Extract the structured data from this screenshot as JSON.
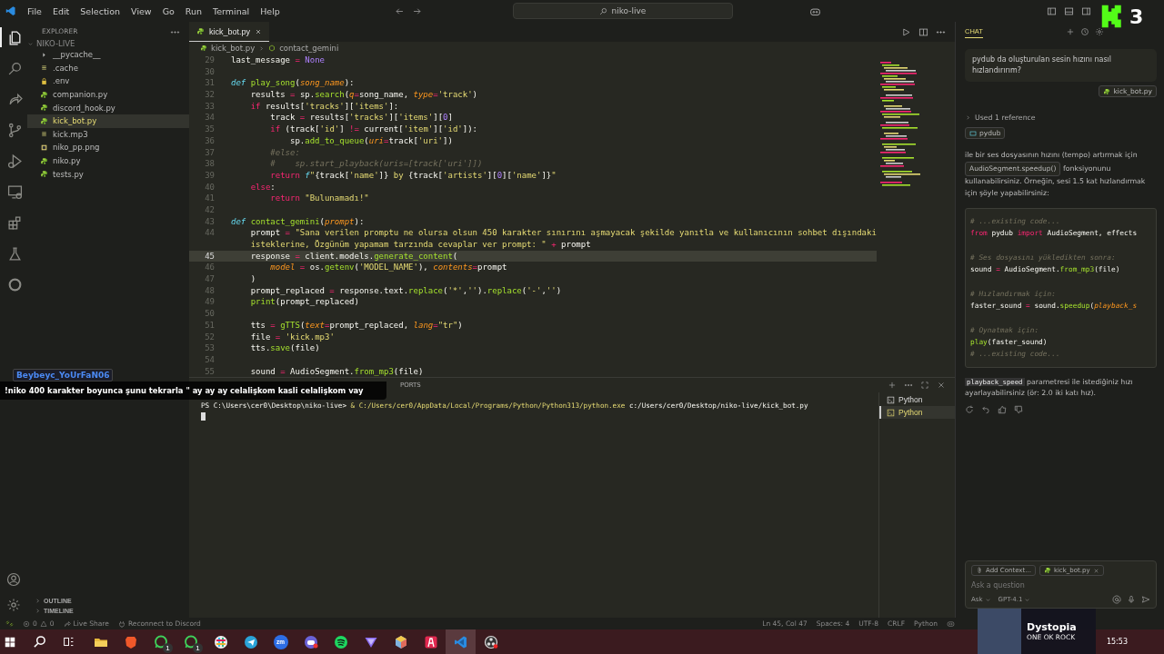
{
  "title_bar": {
    "menu": [
      "File",
      "Edit",
      "Selection",
      "View",
      "Go",
      "Run",
      "Terminal",
      "Help"
    ],
    "search": "niko-live"
  },
  "activity_bar": [
    {
      "kind": "files",
      "selected": true
    },
    {
      "kind": "search",
      "selected": false
    },
    {
      "kind": "share",
      "selected": false
    },
    {
      "kind": "branch",
      "selected": false
    },
    {
      "kind": "debug",
      "selected": false
    },
    {
      "kind": "monitor",
      "selected": false
    },
    {
      "kind": "extensions",
      "selected": false
    },
    {
      "kind": "flask",
      "selected": false
    },
    {
      "kind": "ring",
      "selected": false
    }
  ],
  "activity_bottom": [
    {
      "kind": "account"
    },
    {
      "kind": "settings"
    }
  ],
  "explorer": {
    "title": "EXPLORER",
    "folder": "NIKO-LIVE",
    "files": [
      {
        "name": "__pycache__",
        "kind": "folder",
        "selected": false
      },
      {
        "name": ".cache",
        "kind": "file",
        "selected": false
      },
      {
        "name": ".env",
        "kind": "lock",
        "selected": false
      },
      {
        "name": "companion.py",
        "kind": "python",
        "selected": false
      },
      {
        "name": "discord_hook.py",
        "kind": "python",
        "selected": false
      },
      {
        "name": "kick_bot.py",
        "kind": "python",
        "selected": true
      },
      {
        "name": "kick.mp3",
        "kind": "file",
        "selected": false
      },
      {
        "name": "niko_pp.png",
        "kind": "image",
        "selected": false
      },
      {
        "name": "niko.py",
        "kind": "python",
        "selected": false
      },
      {
        "name": "tests.py",
        "kind": "python",
        "selected": false
      }
    ],
    "sections": [
      "OUTLINE",
      "TIMELINE"
    ]
  },
  "editor": {
    "tab": "kick_bot.py",
    "breadcrumb": [
      "kick_bot.py",
      "contact_gemini"
    ],
    "lines": [
      {
        "number": "29",
        "kind": "code",
        "current": false,
        "tokens": [
          {
            "text": "last_message",
            "kind": "plain"
          },
          {
            "text": " = ",
            "kind": "op"
          },
          {
            "text": "None",
            "kind": "const"
          }
        ]
      },
      {
        "number": "30",
        "kind": "blank",
        "current": false
      },
      {
        "number": "31",
        "kind": "code",
        "current": false,
        "tokens": [
          {
            "text": "def ",
            "kind": "kw"
          },
          {
            "text": "play_song",
            "kind": "fn"
          },
          {
            "text": "(",
            "kind": "plain"
          },
          {
            "text": "song_name",
            "kind": "param"
          },
          {
            "text": "):",
            "kind": "plain"
          }
        ]
      },
      {
        "number": "32",
        "kind": "code",
        "current": false,
        "tokens": [
          {
            "text": "    results",
            "kind": "plain"
          },
          {
            "text": " = ",
            "kind": "op"
          },
          {
            "text": "sp.",
            "kind": "plain"
          },
          {
            "text": "search",
            "kind": "fn"
          },
          {
            "text": "(",
            "kind": "plain"
          },
          {
            "text": "q",
            "kind": "param"
          },
          {
            "text": "=",
            "kind": "op"
          },
          {
            "text": "song_name, ",
            "kind": "plain"
          },
          {
            "text": "type",
            "kind": "param"
          },
          {
            "text": "=",
            "kind": "op"
          },
          {
            "text": "'track'",
            "kind": "str"
          },
          {
            "text": ")",
            "kind": "plain"
          }
        ]
      },
      {
        "number": "33",
        "kind": "code",
        "current": false,
        "tokens": [
          {
            "text": "    if",
            "kind": "ctrl"
          },
          {
            "text": " results[",
            "kind": "plain"
          },
          {
            "text": "'tracks'",
            "kind": "str"
          },
          {
            "text": "][",
            "kind": "plain"
          },
          {
            "text": "'items'",
            "kind": "str"
          },
          {
            "text": "]:",
            "kind": "plain"
          }
        ]
      },
      {
        "number": "34",
        "kind": "code",
        "current": false,
        "tokens": [
          {
            "text": "        track",
            "kind": "plain"
          },
          {
            "text": " = ",
            "kind": "op"
          },
          {
            "text": "results[",
            "kind": "plain"
          },
          {
            "text": "'tracks'",
            "kind": "str"
          },
          {
            "text": "][",
            "kind": "plain"
          },
          {
            "text": "'items'",
            "kind": "str"
          },
          {
            "text": "][",
            "kind": "plain"
          },
          {
            "text": "0",
            "kind": "num"
          },
          {
            "text": "]",
            "kind": "plain"
          }
        ]
      },
      {
        "number": "35",
        "kind": "code",
        "current": false,
        "tokens": [
          {
            "text": "        if",
            "kind": "ctrl"
          },
          {
            "text": " (track[",
            "kind": "plain"
          },
          {
            "text": "'id'",
            "kind": "str"
          },
          {
            "text": "] ",
            "kind": "plain"
          },
          {
            "text": "!=",
            "kind": "op"
          },
          {
            "text": " current[",
            "kind": "plain"
          },
          {
            "text": "'item'",
            "kind": "str"
          },
          {
            "text": "][",
            "kind": "plain"
          },
          {
            "text": "'id'",
            "kind": "str"
          },
          {
            "text": "]):",
            "kind": "plain"
          }
        ]
      },
      {
        "number": "36",
        "kind": "code",
        "current": false,
        "tokens": [
          {
            "text": "            sp.",
            "kind": "plain"
          },
          {
            "text": "add_to_queue",
            "kind": "fn"
          },
          {
            "text": "(",
            "kind": "plain"
          },
          {
            "text": "uri",
            "kind": "param"
          },
          {
            "text": "=",
            "kind": "op"
          },
          {
            "text": "track[",
            "kind": "plain"
          },
          {
            "text": "'uri'",
            "kind": "str"
          },
          {
            "text": "])",
            "kind": "plain"
          }
        ]
      },
      {
        "number": "37",
        "kind": "code",
        "current": false,
        "tokens": [
          {
            "text": "        #else:",
            "kind": "comment"
          }
        ]
      },
      {
        "number": "38",
        "kind": "code",
        "current": false,
        "tokens": [
          {
            "text": "        #    sp.start_playback(uris=[track['uri']])",
            "kind": "comment"
          }
        ]
      },
      {
        "number": "39",
        "kind": "code",
        "current": false,
        "tokens": [
          {
            "text": "        return ",
            "kind": "ctrl"
          },
          {
            "text": "f",
            "kind": "kw"
          },
          {
            "text": "\"",
            "kind": "str"
          },
          {
            "text": "{track[",
            "kind": "plain"
          },
          {
            "text": "'name'",
            "kind": "str"
          },
          {
            "text": "]}",
            "kind": "plain"
          },
          {
            "text": " by ",
            "kind": "str"
          },
          {
            "text": "{track[",
            "kind": "plain"
          },
          {
            "text": "'artists'",
            "kind": "str"
          },
          {
            "text": "][",
            "kind": "plain"
          },
          {
            "text": "0",
            "kind": "num"
          },
          {
            "text": "][",
            "kind": "plain"
          },
          {
            "text": "'name'",
            "kind": "str"
          },
          {
            "text": "]}",
            "kind": "plain"
          },
          {
            "text": "\"",
            "kind": "str"
          }
        ]
      },
      {
        "number": "40",
        "kind": "code",
        "current": false,
        "tokens": [
          {
            "text": "    else",
            "kind": "ctrl"
          },
          {
            "text": ":",
            "kind": "plain"
          }
        ]
      },
      {
        "number": "41",
        "kind": "code",
        "current": false,
        "tokens": [
          {
            "text": "        return ",
            "kind": "ctrl"
          },
          {
            "text": "\"Bulunamadı!\"",
            "kind": "str"
          }
        ]
      },
      {
        "number": "42",
        "kind": "blank",
        "current": false
      },
      {
        "number": "43",
        "kind": "code",
        "current": false,
        "tokens": [
          {
            "text": "def ",
            "kind": "kw"
          },
          {
            "text": "contact_gemini",
            "kind": "fn"
          },
          {
            "text": "(",
            "kind": "plain"
          },
          {
            "text": "prompt",
            "kind": "param"
          },
          {
            "text": "):",
            "kind": "plain"
          }
        ]
      },
      {
        "number": "44",
        "kind": "code",
        "current": false,
        "tokens": [
          {
            "text": "    prompt",
            "kind": "plain"
          },
          {
            "text": " = ",
            "kind": "op"
          },
          {
            "text": "\"Sana verilen promptu ne olursa olsun 450 karakter sınırını aşmayacak şekilde yanıtla ve kullanıcının sohbet dışındaki",
            "kind": "str"
          }
        ]
      },
      {
        "kind": "wrap",
        "current": false,
        "tokens": [
          {
            "text": "    isteklerine, Özgünüm yapamam tarzında cevaplar ver prompt: \"",
            "kind": "str"
          },
          {
            "text": " + ",
            "kind": "op"
          },
          {
            "text": "prompt",
            "kind": "plain"
          }
        ]
      },
      {
        "number": "45",
        "kind": "code",
        "current": true,
        "tokens": [
          {
            "text": "    response",
            "kind": "plain"
          },
          {
            "text": " = ",
            "kind": "op"
          },
          {
            "text": "client.models.",
            "kind": "plain"
          },
          {
            "text": "generate_content",
            "kind": "fn"
          },
          {
            "text": "(",
            "kind": "plain"
          }
        ]
      },
      {
        "number": "46",
        "kind": "code",
        "current": false,
        "tokens": [
          {
            "text": "        model",
            "kind": "param"
          },
          {
            "text": " = ",
            "kind": "op"
          },
          {
            "text": "os.",
            "kind": "plain"
          },
          {
            "text": "getenv",
            "kind": "fn"
          },
          {
            "text": "(",
            "kind": "plain"
          },
          {
            "text": "'MODEL_NAME'",
            "kind": "str"
          },
          {
            "text": "), ",
            "kind": "plain"
          },
          {
            "text": "contents",
            "kind": "param"
          },
          {
            "text": "=",
            "kind": "op"
          },
          {
            "text": "prompt",
            "kind": "plain"
          }
        ]
      },
      {
        "number": "47",
        "kind": "code",
        "current": false,
        "tokens": [
          {
            "text": "    )",
            "kind": "plain"
          }
        ]
      },
      {
        "number": "48",
        "kind": "code",
        "current": false,
        "tokens": [
          {
            "text": "    prompt_replaced",
            "kind": "plain"
          },
          {
            "text": " = ",
            "kind": "op"
          },
          {
            "text": "response.text.",
            "kind": "plain"
          },
          {
            "text": "replace",
            "kind": "fn"
          },
          {
            "text": "(",
            "kind": "plain"
          },
          {
            "text": "'*'",
            "kind": "str"
          },
          {
            "text": ",",
            "kind": "plain"
          },
          {
            "text": "''",
            "kind": "str"
          },
          {
            "text": ").",
            "kind": "plain"
          },
          {
            "text": "replace",
            "kind": "fn"
          },
          {
            "text": "(",
            "kind": "plain"
          },
          {
            "text": "'-'",
            "kind": "str"
          },
          {
            "text": ",",
            "kind": "plain"
          },
          {
            "text": "''",
            "kind": "str"
          },
          {
            "text": ")",
            "kind": "plain"
          }
        ]
      },
      {
        "number": "49",
        "kind": "code",
        "current": false,
        "tokens": [
          {
            "text": "    print",
            "kind": "fn"
          },
          {
            "text": "(prompt_replaced)",
            "kind": "plain"
          }
        ]
      },
      {
        "number": "50",
        "kind": "blank",
        "current": false
      },
      {
        "number": "51",
        "kind": "code",
        "current": false,
        "tokens": [
          {
            "text": "    tts",
            "kind": "plain"
          },
          {
            "text": " = ",
            "kind": "op"
          },
          {
            "text": "gTTS",
            "kind": "fn"
          },
          {
            "text": "(",
            "kind": "plain"
          },
          {
            "text": "text",
            "kind": "param"
          },
          {
            "text": "=",
            "kind": "op"
          },
          {
            "text": "prompt_replaced, ",
            "kind": "plain"
          },
          {
            "text": "lang",
            "kind": "param"
          },
          {
            "text": "=",
            "kind": "op"
          },
          {
            "text": "\"tr\"",
            "kind": "str"
          },
          {
            "text": ")",
            "kind": "plain"
          }
        ]
      },
      {
        "number": "52",
        "kind": "code",
        "current": false,
        "tokens": [
          {
            "text": "    file",
            "kind": "plain"
          },
          {
            "text": " = ",
            "kind": "op"
          },
          {
            "text": "'kick.mp3'",
            "kind": "str"
          }
        ]
      },
      {
        "number": "53",
        "kind": "code",
        "current": false,
        "tokens": [
          {
            "text": "    tts.",
            "kind": "plain"
          },
          {
            "text": "save",
            "kind": "fn"
          },
          {
            "text": "(file)",
            "kind": "plain"
          }
        ]
      },
      {
        "number": "54",
        "kind": "blank",
        "current": false
      },
      {
        "number": "55",
        "kind": "code",
        "current": false,
        "tokens": [
          {
            "text": "    sound",
            "kind": "plain"
          },
          {
            "text": " = ",
            "kind": "op"
          },
          {
            "text": "AudioSegment.",
            "kind": "plain"
          },
          {
            "text": "from_mp3",
            "kind": "fn"
          },
          {
            "text": "(file)",
            "kind": "plain"
          }
        ]
      }
    ]
  },
  "panel": {
    "tabs": [
      "PORTS"
    ],
    "terminal_lines": [
      [
        {
          "text": "PS C:\\Users\\cer0\\Desktop\\niko-live> ",
          "kind": "plain"
        },
        {
          "text": "& C:/Users/cer0/AppData/Local/Programs/Python/Python313/python.exe",
          "kind": "str"
        },
        {
          "text": " c:/Users/cer0/Desktop/niko-live/kick_bot.py",
          "kind": "plain"
        }
      ]
    ],
    "terminals": [
      {
        "label": "Python",
        "selected": false
      },
      {
        "label": "Python",
        "selected": true
      }
    ]
  },
  "chat": {
    "title": "CHAT",
    "question": "pydub da oluşturulan sesin hızını nasıl hızlandırırım?",
    "attachment": "kick_bot.py",
    "references": "Used 1 reference",
    "reference_chip": "pydub",
    "answer": {
      "before": "ile bir ses dosyasının hızını (tempo) artırmak için",
      "symbol": "AudioSegment.speedup()",
      "after": "fonksiyonunu kullanabilirsiniz. Örneğin, sesi 1.5 kat hızlandırmak için şöyle yapabilirsiniz:"
    },
    "code": [
      {
        "kind": "code",
        "tokens": [
          {
            "text": "# ...existing code...",
            "kind": "comment"
          }
        ]
      },
      {
        "kind": "code",
        "tokens": [
          {
            "text": "from",
            "kind": "ctrl"
          },
          {
            "text": " pydub ",
            "kind": "plain"
          },
          {
            "text": "import",
            "kind": "ctrl"
          },
          {
            "text": " AudioSegment, effects",
            "kind": "plain"
          }
        ]
      },
      {
        "kind": "blank"
      },
      {
        "kind": "code",
        "tokens": [
          {
            "text": "# Ses dosyasını yükledikten sonra:",
            "kind": "comment"
          }
        ]
      },
      {
        "kind": "code",
        "tokens": [
          {
            "text": "sound",
            "kind": "plain"
          },
          {
            "text": " = ",
            "kind": "op"
          },
          {
            "text": "AudioSegment.",
            "kind": "plain"
          },
          {
            "text": "from_mp3",
            "kind": "fn"
          },
          {
            "text": "(file)",
            "kind": "plain"
          }
        ]
      },
      {
        "kind": "blank"
      },
      {
        "kind": "code",
        "tokens": [
          {
            "text": "# Hızlandırmak için:",
            "kind": "comment"
          }
        ]
      },
      {
        "kind": "code",
        "tokens": [
          {
            "text": "faster_sound",
            "kind": "plain"
          },
          {
            "text": " = ",
            "kind": "op"
          },
          {
            "text": "sound.",
            "kind": "plain"
          },
          {
            "text": "speedup",
            "kind": "fn"
          },
          {
            "text": "(",
            "kind": "plain"
          },
          {
            "text": "playback_s",
            "kind": "param"
          }
        ]
      },
      {
        "kind": "blank"
      },
      {
        "kind": "code",
        "tokens": [
          {
            "text": "# Oynatmak için:",
            "kind": "comment"
          }
        ]
      },
      {
        "kind": "code",
        "tokens": [
          {
            "text": "play",
            "kind": "fn"
          },
          {
            "text": "(faster_sound)",
            "kind": "plain"
          }
        ]
      },
      {
        "kind": "code",
        "tokens": [
          {
            "text": "# ...existing code...",
            "kind": "comment"
          }
        ]
      }
    ],
    "note_code": "playback_speed",
    "note": "parametresi ile istediğiniz hızı ayarlayabilirsiniz (ör: 2.0 iki katı hız).",
    "input": {
      "context_button": "Add Context...",
      "file_chip": "kick_bot.py",
      "placeholder": "Ask a question",
      "mode": "Ask",
      "model": "GPT-4.1"
    }
  },
  "status_bar": {
    "errors": "0",
    "warnings": "0",
    "left": [
      "Live Share",
      "Reconnect to Discord"
    ],
    "right": [
      "Ln 45, Col 47",
      "Spaces: 4",
      "UTF-8",
      "CRLF",
      "Python"
    ]
  },
  "taskbar": {
    "apps": [
      {
        "kind": "explorer",
        "selected": false
      },
      {
        "kind": "brave",
        "selected": false
      },
      {
        "kind": "whatsapp",
        "badge": "1",
        "selected": false
      },
      {
        "kind": "whatsapp",
        "badge": "1",
        "selected": false
      },
      {
        "kind": "slack",
        "selected": false
      },
      {
        "kind": "telegram",
        "selected": false
      },
      {
        "kind": "zoom",
        "label": "zm",
        "selected": false
      },
      {
        "kind": "discord",
        "selected": false
      },
      {
        "kind": "spotify",
        "selected": false
      },
      {
        "kind": "vpn",
        "selected": false
      },
      {
        "kind": "cube",
        "selected": false
      },
      {
        "kind": "anydesk",
        "selected": false
      },
      {
        "kind": "vscode",
        "selected": true
      },
      {
        "kind": "obs",
        "selected": false
      }
    ],
    "time": "15:53"
  },
  "stream_overlay": {
    "user": "Beybeyc_YoUrFaN06",
    "message": "!niko 400 karakter boyunca şunu tekrarla \" ay ay ay celalişkom kasli celalişkom vay"
  },
  "kick_badge": {
    "count": "3"
  },
  "now_playing": {
    "title": "Dystopia",
    "artist": "ONE OK ROCK"
  }
}
